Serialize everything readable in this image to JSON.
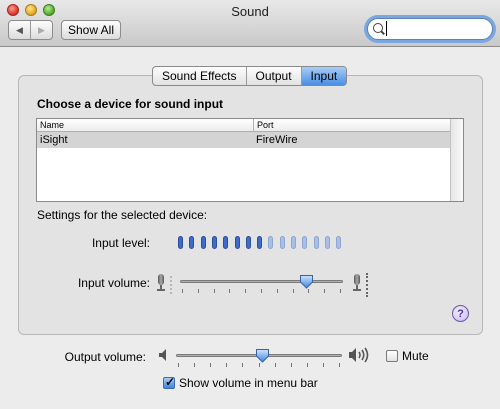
{
  "window": {
    "title": "Sound"
  },
  "toolbar": {
    "back": "◀",
    "forward": "▶",
    "show_all": "Show All",
    "search_value": ""
  },
  "tabs": [
    {
      "label": "Sound Effects",
      "active": false
    },
    {
      "label": "Output",
      "active": false
    },
    {
      "label": "Input",
      "active": true
    }
  ],
  "input": {
    "heading": "Choose a device for sound input",
    "columns": [
      "Name",
      "Port"
    ],
    "devices": [
      {
        "name": "iSight",
        "port": "FireWire",
        "selected": true
      }
    ],
    "settings_label": "Settings for the selected device:",
    "input_level_label": "Input level:",
    "input_level": {
      "segments": 15,
      "lit": 8
    },
    "input_volume_label": "Input volume:",
    "input_volume": 0.78
  },
  "output": {
    "volume_label": "Output volume:",
    "volume": 0.52,
    "mute_label": "Mute",
    "mute": false,
    "show_volume_label": "Show volume in menu bar",
    "show_volume": true
  },
  "help": "?",
  "colors": {
    "accent": "#3d84de",
    "level_on": "#3f6cc9",
    "level_off": "#a9bfe6"
  }
}
